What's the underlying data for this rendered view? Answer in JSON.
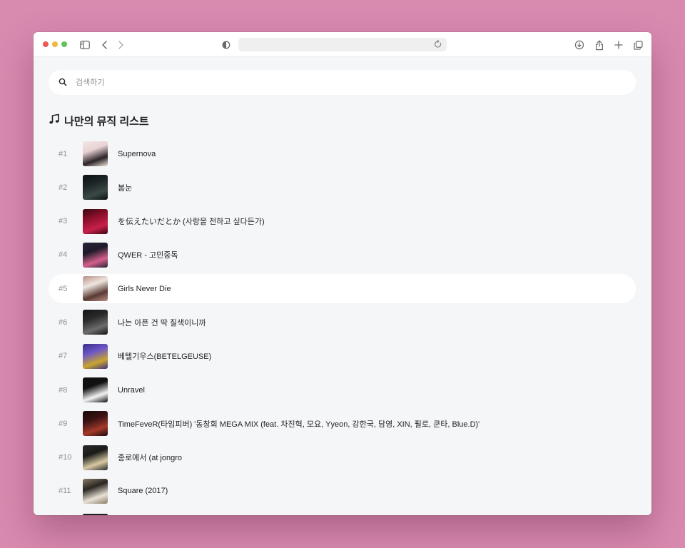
{
  "browser": {
    "address": ""
  },
  "search": {
    "placeholder": "검색하기",
    "value": ""
  },
  "list": {
    "icon": "music-note-icon",
    "title": "나만의 뮤직 리스트",
    "active_index": 5,
    "tracks": [
      {
        "rank": "#1",
        "title": "Supernova",
        "thumb_colors": [
          "#e9d2d6",
          "#2b2326",
          "#f2e6e0"
        ]
      },
      {
        "rank": "#2",
        "title": "봄눈",
        "thumb_colors": [
          "#1c2426",
          "#3a4a46",
          "#0e1213"
        ]
      },
      {
        "rank": "#3",
        "title": "を伝えたいだとか (사랑을 전하고 싶다든가)",
        "thumb_colors": [
          "#8b0f2a",
          "#c8204a",
          "#3a0612"
        ]
      },
      {
        "rank": "#4",
        "title": "QWER - 고민중독",
        "thumb_colors": [
          "#1e1a2a",
          "#d45f8b",
          "#2a2438"
        ]
      },
      {
        "rank": "#5",
        "title": "Girls Never Die",
        "thumb_colors": [
          "#efe6e0",
          "#5a3a34",
          "#b98f86"
        ]
      },
      {
        "rank": "#6",
        "title": "나는 아픈 건 딱 질색이니까",
        "thumb_colors": [
          "#2a2a2a",
          "#6d6d6d",
          "#141414"
        ]
      },
      {
        "rank": "#7",
        "title": "베텔기우스(BETELGEUSE)",
        "thumb_colors": [
          "#6d57c8",
          "#c9a52e",
          "#3c2f86"
        ]
      },
      {
        "rank": "#8",
        "title": "Unravel",
        "thumb_colors": [
          "#111111",
          "#f3f3f3",
          "#111111"
        ]
      },
      {
        "rank": "#9",
        "title": "TimeFeveR(타임피버) '동창회 MEGA MIX (feat. 차진혁, 모요, Yyeon, 강한국, 담영, XIN, 필로, 쿤타, Blue.D)'",
        "thumb_colors": [
          "#3a1212",
          "#a43a2a",
          "#1a0a0a"
        ]
      },
      {
        "rank": "#10",
        "title": "종로에서 (at jongro",
        "thumb_colors": [
          "#1a1a1a",
          "#d9c9a4",
          "#2a2a2a"
        ]
      },
      {
        "rank": "#11",
        "title": "Square (2017)",
        "thumb_colors": [
          "#2a2622",
          "#e8e2d6",
          "#8a7c66"
        ]
      }
    ]
  }
}
